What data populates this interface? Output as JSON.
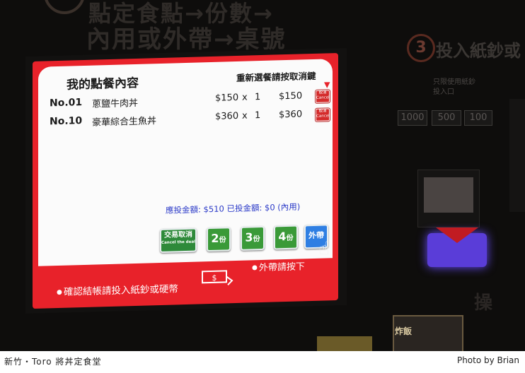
{
  "photo": {
    "background_signage": {
      "line1": "點定食點→份數→",
      "line2": "內用或外帶→桌號",
      "step3_number": "3",
      "step3_text": "投入紙鈔或",
      "bill_slot_label_1": "只限使用紙鈔",
      "bill_slot_label_2": "投入口",
      "bills": [
        "1000",
        "500",
        "100"
      ],
      "step4_text": "操",
      "fried_sign": "炸飯"
    },
    "screen": {
      "order_title": "我的點餐內容",
      "reselect_hint": "重新選餐請按取消鍵",
      "orders": [
        {
          "no": "No.01",
          "name": "蔥鹽牛肉丼",
          "price": "$150",
          "x": "x",
          "qty": "1",
          "total": "$150",
          "cancel_label": "取消",
          "cancel_en": "Cancel"
        },
        {
          "no": "No.10",
          "name": "豪華綜合生魚丼",
          "price": "$360",
          "x": "x",
          "qty": "1",
          "total": "$360",
          "cancel_label": "取消",
          "cancel_en": "Cancel"
        }
      ],
      "amount_due_label": "應投金額:",
      "amount_due": "$510",
      "amount_paid_label": "已投金額:",
      "amount_paid": "$0",
      "dine_mode": "(內用)",
      "buttons": {
        "cancel_deal": "交易取消",
        "cancel_deal_en": "Cancel the deal",
        "qty2": "2",
        "qty3": "3",
        "qty4": "4",
        "qty_unit": "份",
        "takeout": "外帶"
      },
      "takeout_hint": "外帶請按下",
      "confirm_hint": "確認結帳請投入紙鈔或硬幣"
    }
  },
  "footer": {
    "caption": "新竹・Toro 將丼定食堂",
    "credit": "Photo by Brian"
  },
  "colors": {
    "screen_red": "#e8222a",
    "button_green": "#3a9a38",
    "button_blue": "#2f7fe3",
    "amount_blue": "#2b3ac8"
  }
}
